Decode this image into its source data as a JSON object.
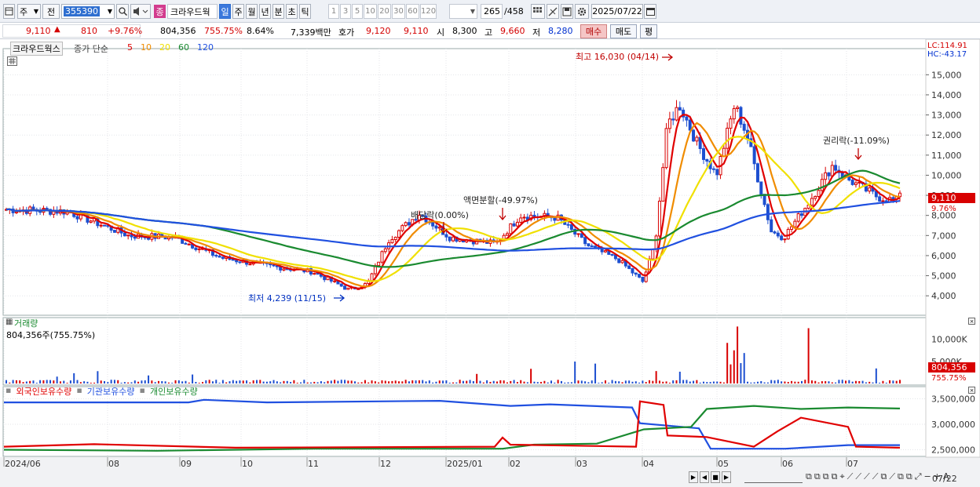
{
  "toolbar": {
    "market": "주",
    "prev": "전",
    "code": "355390",
    "type_badge": "종",
    "name": "크라우드웍",
    "periods": [
      "일",
      "주",
      "월",
      "년",
      "분",
      "초",
      "틱"
    ],
    "intervals": [
      "1",
      "3",
      "5",
      "10",
      "20",
      "30",
      "60",
      "120"
    ],
    "count": "265",
    "total": "/458",
    "date": "2025/07/22"
  },
  "quote": {
    "price": "9,110",
    "change": "810",
    "change_pct": "+9.76%",
    "volume": "804,356",
    "vol_pct": "755.75%",
    "turnover": "8.64%",
    "amount": "7,339백만",
    "bid_label": "호가",
    "bid": "9,120",
    "ask": "9,110",
    "open_label": "시",
    "open": "8,300",
    "high_label": "고",
    "high": "9,660",
    "low_label": "저",
    "low": "8,280",
    "buy": "매수",
    "sell": "매도",
    "avg": "평"
  },
  "price_panel": {
    "name": "크라우드웍스",
    "ma_label": "종가 단순",
    "ma_periods": [
      "5",
      "10",
      "20",
      "60",
      "120"
    ],
    "ma_colors": {
      "5": "#e00000",
      "10": "#f08c00",
      "20": "#f0e000",
      "60": "#1a8a30",
      "120": "#2050e0"
    },
    "lc": "LC:114.91",
    "hc": "HC:-43.17",
    "y_ticks": [
      "15,000",
      "14,000",
      "13,000",
      "12,000",
      "11,000",
      "10,000",
      "9,000",
      "8,000",
      "7,000",
      "6,000",
      "5,000",
      "4,000"
    ],
    "current_tag": "9,110",
    "current_pct": "9.76%",
    "annotations": {
      "high": "최고 16,030 (04/14)",
      "low": "최저 4,239 (11/15)",
      "dividend": "배당락(0.00%)",
      "split": "액면분할(-49.97%)",
      "rights": "권리락(-11.09%)"
    }
  },
  "volume_panel": {
    "title": "거래량",
    "value": "804,356주(755.75%)",
    "y_ticks": [
      "10,000K",
      "5,000K"
    ],
    "current_tag": "804,356",
    "current_pct": "755.75%"
  },
  "holdings_panel": {
    "legends": [
      "외국인보유수량",
      "기관보유수량",
      "개인보유수량"
    ],
    "legend_colors": [
      "#e00000",
      "#2050e0",
      "#1a8a30"
    ],
    "y_ticks": [
      "3,500,000",
      "3,000,000",
      "2,500,000"
    ]
  },
  "x_axis": {
    "labels": [
      "2024/06",
      "08",
      "09",
      "10",
      "11",
      "12",
      "2025/01",
      "02",
      "03",
      "04",
      "05",
      "06",
      "07"
    ],
    "end_label": "07/22"
  }
}
